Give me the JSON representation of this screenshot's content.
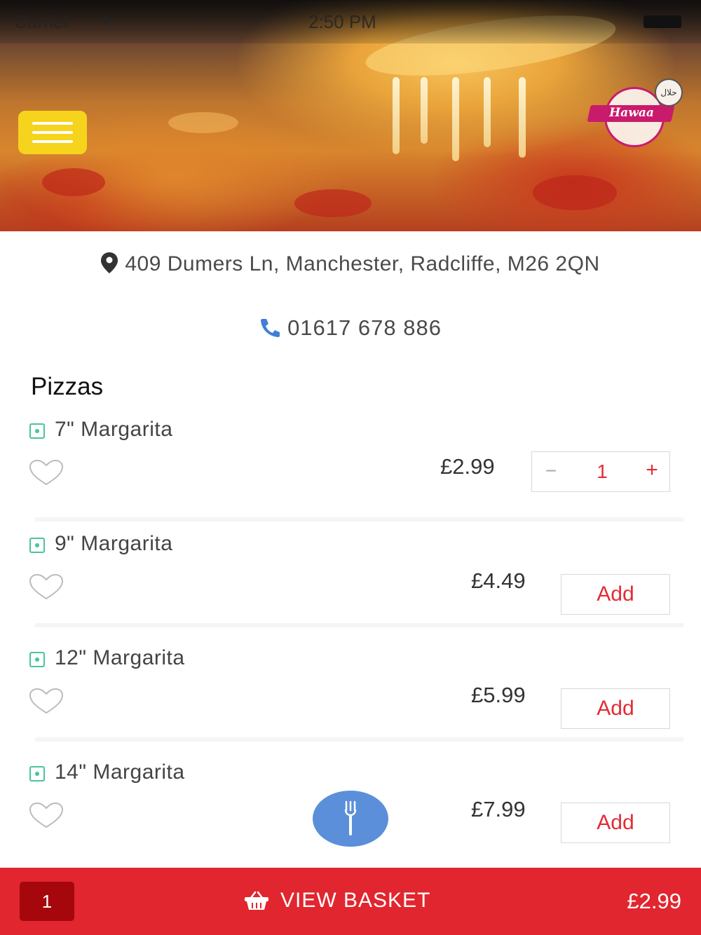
{
  "status_bar": {
    "carrier": "Carrier",
    "time": "2:50 PM"
  },
  "header": {
    "logo_text": "Hawaa",
    "halal_badge": "حلال"
  },
  "restaurant": {
    "address": "409 Dumers Ln, Manchester, Radcliffe, M26 2QN",
    "phone": "01617 678 886"
  },
  "menu": {
    "category": "Pizzas",
    "items": [
      {
        "name": "7\" Margarita",
        "price": "£2.99",
        "quantity": "1"
      },
      {
        "name": "9\" Margarita",
        "price": "£4.49",
        "action": "Add"
      },
      {
        "name": "12\" Margarita",
        "price": "£5.99",
        "action": "Add"
      },
      {
        "name": "14\" Margarita",
        "price": "£7.99",
        "action": "Add"
      }
    ]
  },
  "stepper": {
    "minus": "−",
    "plus": "+"
  },
  "basket": {
    "count": "1",
    "label": "VIEW BASKET",
    "total": "£2.99"
  },
  "colors": {
    "accent_red": "#e1262f",
    "menu_button": "#f6d31c",
    "fab_blue": "#5b8fd9",
    "veg_green": "#49c59a",
    "phone_blue": "#3f7fd6"
  },
  "icons": [
    "wifi-icon",
    "battery-icon",
    "menu-icon",
    "pin-icon",
    "phone-icon",
    "veg-icon",
    "heart-icon",
    "fork-icon",
    "basket-icon"
  ]
}
